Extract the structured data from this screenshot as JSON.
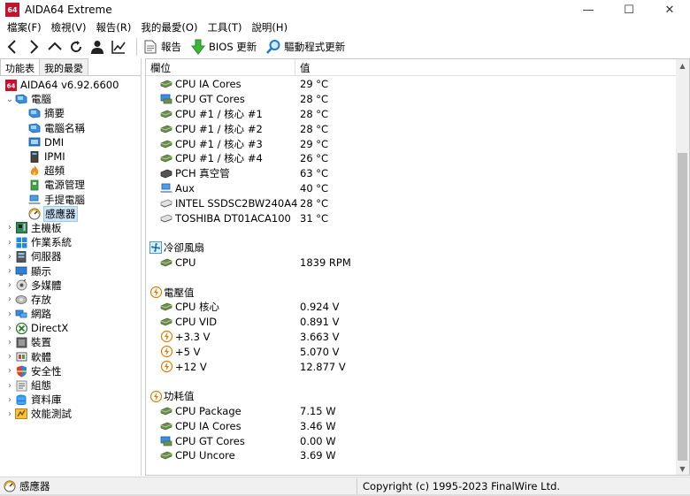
{
  "window": {
    "logo_text": "64",
    "title": "AIDA64 Extreme",
    "minimize": "—",
    "maximize": "☐",
    "close": "✕"
  },
  "menu": [
    "檔案(F)",
    "檢視(V)",
    "報告(R)",
    "我的最愛(O)",
    "工具(T)",
    "說明(H)"
  ],
  "toolbar": {
    "report": "報告",
    "bios_update": "BIOS 更新",
    "driver_update": "驅動程式更新"
  },
  "left_tabs": [
    "功能表",
    "我的最愛"
  ],
  "tree": [
    {
      "label": "AIDA64 v6.92.6600",
      "icon": "aida-logo-icon",
      "level": 0,
      "exp": ""
    },
    {
      "label": "電腦",
      "icon": "computer-icon",
      "level": 0,
      "exp": "⌄"
    },
    {
      "label": "摘要",
      "icon": "computer-icon",
      "level": 1,
      "exp": ""
    },
    {
      "label": "電腦名稱",
      "icon": "computer-icon",
      "level": 1,
      "exp": ""
    },
    {
      "label": "DMI",
      "icon": "dmi-icon",
      "level": 1,
      "exp": ""
    },
    {
      "label": "IPMI",
      "icon": "ipmi-icon",
      "level": 1,
      "exp": ""
    },
    {
      "label": "超頻",
      "icon": "fire-icon",
      "level": 1,
      "exp": ""
    },
    {
      "label": "電源管理",
      "icon": "power-icon",
      "level": 1,
      "exp": ""
    },
    {
      "label": "手提電腦",
      "icon": "laptop-icon",
      "level": 1,
      "exp": ""
    },
    {
      "label": "感應器",
      "icon": "sensor-icon",
      "level": 1,
      "exp": "",
      "selected": true
    },
    {
      "label": "主機板",
      "icon": "motherboard-icon",
      "level": 0,
      "exp": "›"
    },
    {
      "label": "作業系統",
      "icon": "windows-icon",
      "level": 0,
      "exp": "›"
    },
    {
      "label": "伺服器",
      "icon": "server-icon",
      "level": 0,
      "exp": "›"
    },
    {
      "label": "顯示",
      "icon": "display-icon",
      "level": 0,
      "exp": "›"
    },
    {
      "label": "多媒體",
      "icon": "multimedia-icon",
      "level": 0,
      "exp": "›"
    },
    {
      "label": "存放",
      "icon": "storage-icon",
      "level": 0,
      "exp": "›"
    },
    {
      "label": "網路",
      "icon": "network-icon",
      "level": 0,
      "exp": "›"
    },
    {
      "label": "DirectX",
      "icon": "directx-icon",
      "level": 0,
      "exp": "›"
    },
    {
      "label": "裝置",
      "icon": "device-icon",
      "level": 0,
      "exp": "›"
    },
    {
      "label": "軟體",
      "icon": "software-icon",
      "level": 0,
      "exp": "›"
    },
    {
      "label": "安全性",
      "icon": "security-icon",
      "level": 0,
      "exp": "›"
    },
    {
      "label": "組態",
      "icon": "config-icon",
      "level": 0,
      "exp": "›"
    },
    {
      "label": "資料庫",
      "icon": "database-icon",
      "level": 0,
      "exp": "›"
    },
    {
      "label": "效能測試",
      "icon": "benchmark-icon",
      "level": 0,
      "exp": "›"
    }
  ],
  "columns": {
    "field": "欄位",
    "value": "值"
  },
  "rows": [
    {
      "kind": "row",
      "label": "CPU IA Cores",
      "value": "29 °C",
      "icon": "chip-icon"
    },
    {
      "kind": "row",
      "label": "CPU GT Cores",
      "value": "28 °C",
      "icon": "gpu-icon"
    },
    {
      "kind": "row",
      "label": "CPU #1 / 核心 #1",
      "value": "28 °C",
      "icon": "chip-icon"
    },
    {
      "kind": "row",
      "label": "CPU #1 / 核心 #2",
      "value": "28 °C",
      "icon": "chip-icon"
    },
    {
      "kind": "row",
      "label": "CPU #1 / 核心 #3",
      "value": "29 °C",
      "icon": "chip-icon"
    },
    {
      "kind": "row",
      "label": "CPU #1 / 核心 #4",
      "value": "26 °C",
      "icon": "chip-icon"
    },
    {
      "kind": "row",
      "label": "PCH 真空管",
      "value": "63 °C",
      "icon": "pch-icon"
    },
    {
      "kind": "row",
      "label": "Aux",
      "value": "40 °C",
      "icon": "laptop-icon"
    },
    {
      "kind": "row",
      "label": "INTEL SSDSC2BW240A4",
      "value": "28 °C",
      "icon": "disk-icon"
    },
    {
      "kind": "row",
      "label": "TOSHIBA DT01ACA100",
      "value": "31 °C",
      "icon": "disk-icon"
    },
    {
      "kind": "spacer"
    },
    {
      "kind": "group",
      "label": "冷卻風扇",
      "icon": "fan-icon"
    },
    {
      "kind": "row",
      "label": "CPU",
      "value": "1839 RPM",
      "icon": "chip-icon"
    },
    {
      "kind": "spacer"
    },
    {
      "kind": "group",
      "label": "電壓值",
      "icon": "voltage-icon"
    },
    {
      "kind": "row",
      "label": "CPU 核心",
      "value": "0.924 V",
      "icon": "chip-icon"
    },
    {
      "kind": "row",
      "label": "CPU VID",
      "value": "0.891 V",
      "icon": "chip-icon"
    },
    {
      "kind": "row",
      "label": "+3.3 V",
      "value": "3.663 V",
      "icon": "voltage-icon"
    },
    {
      "kind": "row",
      "label": "+5 V",
      "value": "5.070 V",
      "icon": "voltage-icon"
    },
    {
      "kind": "row",
      "label": "+12 V",
      "value": "12.877 V",
      "icon": "voltage-icon"
    },
    {
      "kind": "spacer"
    },
    {
      "kind": "group",
      "label": "功耗值",
      "icon": "voltage-icon"
    },
    {
      "kind": "row",
      "label": "CPU Package",
      "value": "7.15 W",
      "icon": "chip-icon"
    },
    {
      "kind": "row",
      "label": "CPU IA Cores",
      "value": "3.46 W",
      "icon": "chip-icon"
    },
    {
      "kind": "row",
      "label": "CPU GT Cores",
      "value": "0.00 W",
      "icon": "gpu-icon"
    },
    {
      "kind": "row",
      "label": "CPU Uncore",
      "value": "3.69 W",
      "icon": "chip-icon"
    }
  ],
  "status": {
    "left": "感應器",
    "right": "Copyright (c) 1995-2023 FinalWire Ltd."
  }
}
